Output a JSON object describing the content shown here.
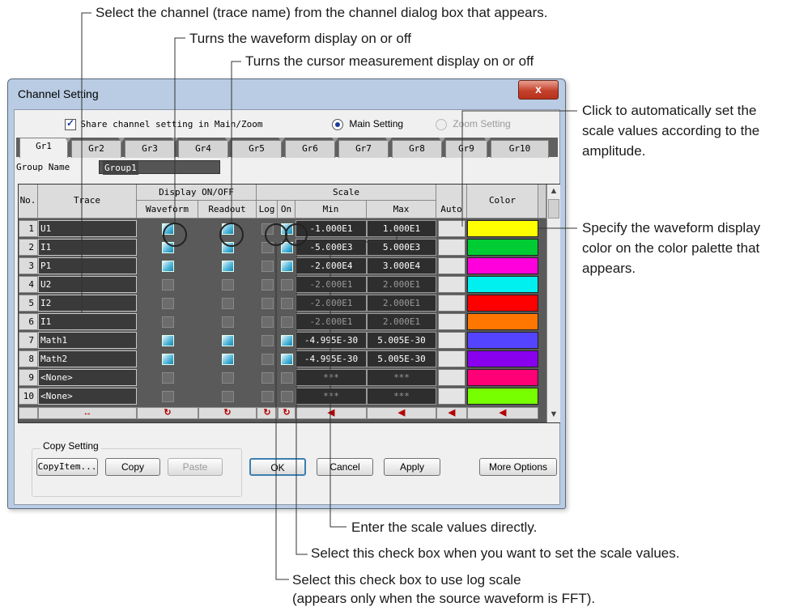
{
  "annotations": {
    "channel_select": "Select the channel (trace name) from the channel dialog box that appears.",
    "waveform_toggle": "Turns the waveform display on or off",
    "cursor_toggle": "Turns the cursor measurement display on or off",
    "auto_scale": [
      "Click to automatically set the",
      "scale values according to the",
      "amplitude."
    ],
    "color_palette": [
      "Specify the waveform display",
      "color on the color palette that",
      "appears."
    ],
    "scale_direct": "Enter the scale values directly.",
    "scale_checkbox": "Select this check box when you want to set the scale values.",
    "log_scale": [
      "Select this check box to use log scale",
      "(appears only when the source waveform is FFT)."
    ]
  },
  "dialog": {
    "title": "Channel Setting",
    "close_label": "x",
    "share_label": "Share channel setting in Main/Zoom",
    "share_checked": true,
    "main_setting_label": "Main Setting",
    "zoom_setting_label": "Zoom Setting",
    "tabs": [
      "Gr1",
      "Gr2",
      "Gr3",
      "Gr4",
      "Gr5",
      "Gr6",
      "Gr7",
      "Gr8",
      "Gr9",
      "Gr10"
    ],
    "selected_tab": "Gr1",
    "group_name_label": "Group Name",
    "group_name_value": "Group1",
    "headers": {
      "no": "No.",
      "trace": "Trace",
      "display": "Display ON/OFF",
      "waveform": "Waveform",
      "readout": "Readout",
      "scale": "Scale",
      "log": "Log",
      "on": "On",
      "min": "Min",
      "max": "Max",
      "auto": "Auto",
      "color": "Color"
    },
    "rows": [
      {
        "no": "1",
        "trace": "U1",
        "waveform": true,
        "readout": true,
        "log": false,
        "on": true,
        "min": "-1.000E1",
        "max": "1.000E1",
        "color": "#ffff00",
        "dim": false
      },
      {
        "no": "2",
        "trace": "I1",
        "waveform": true,
        "readout": true,
        "log": false,
        "on": true,
        "min": "-5.000E3",
        "max": "5.000E3",
        "color": "#00cc33",
        "dim": false
      },
      {
        "no": "3",
        "trace": "P1",
        "waveform": true,
        "readout": true,
        "log": false,
        "on": true,
        "min": "-2.000E4",
        "max": "3.000E4",
        "color": "#ff00dd",
        "dim": false
      },
      {
        "no": "4",
        "trace": "U2",
        "waveform": false,
        "readout": false,
        "log": false,
        "on": false,
        "min": "-2.000E1",
        "max": "2.000E1",
        "color": "#00f0f0",
        "dim": true
      },
      {
        "no": "5",
        "trace": "I2",
        "waveform": false,
        "readout": false,
        "log": false,
        "on": false,
        "min": "-2.000E1",
        "max": "2.000E1",
        "color": "#ff0000",
        "dim": true
      },
      {
        "no": "6",
        "trace": "I1",
        "waveform": false,
        "readout": false,
        "log": false,
        "on": false,
        "min": "-2.000E1",
        "max": "2.000E1",
        "color": "#ff7700",
        "dim": true
      },
      {
        "no": "7",
        "trace": "Math1",
        "waveform": true,
        "readout": true,
        "log": false,
        "on": true,
        "min": "-4.995E-30",
        "max": "5.005E-30",
        "color": "#5544ff",
        "dim": false
      },
      {
        "no": "8",
        "trace": "Math2",
        "waveform": true,
        "readout": true,
        "log": false,
        "on": true,
        "min": "-4.995E-30",
        "max": "5.005E-30",
        "color": "#8800ee",
        "dim": false
      },
      {
        "no": "9",
        "trace": "<None>",
        "waveform": false,
        "readout": false,
        "log": false,
        "on": false,
        "min": "***",
        "max": "***",
        "color": "#ff0077",
        "dim": true
      },
      {
        "no": "10",
        "trace": "<None>",
        "waveform": false,
        "readout": false,
        "log": false,
        "on": false,
        "min": "***",
        "max": "***",
        "color": "#77ff00",
        "dim": true
      }
    ],
    "footer_icons": {
      "trace": "↔",
      "waveform": "↻",
      "readout": "↻",
      "log": "↻",
      "on": "↻",
      "min": "◀",
      "max": "◀",
      "auto": "◀",
      "color": "◀"
    },
    "copy_setting_label": "Copy Setting",
    "buttons": {
      "copy_item": "CopyItem...",
      "copy": "Copy",
      "paste": "Paste",
      "ok": "OK",
      "cancel": "Cancel",
      "apply": "Apply",
      "more_options": "More Options"
    }
  }
}
